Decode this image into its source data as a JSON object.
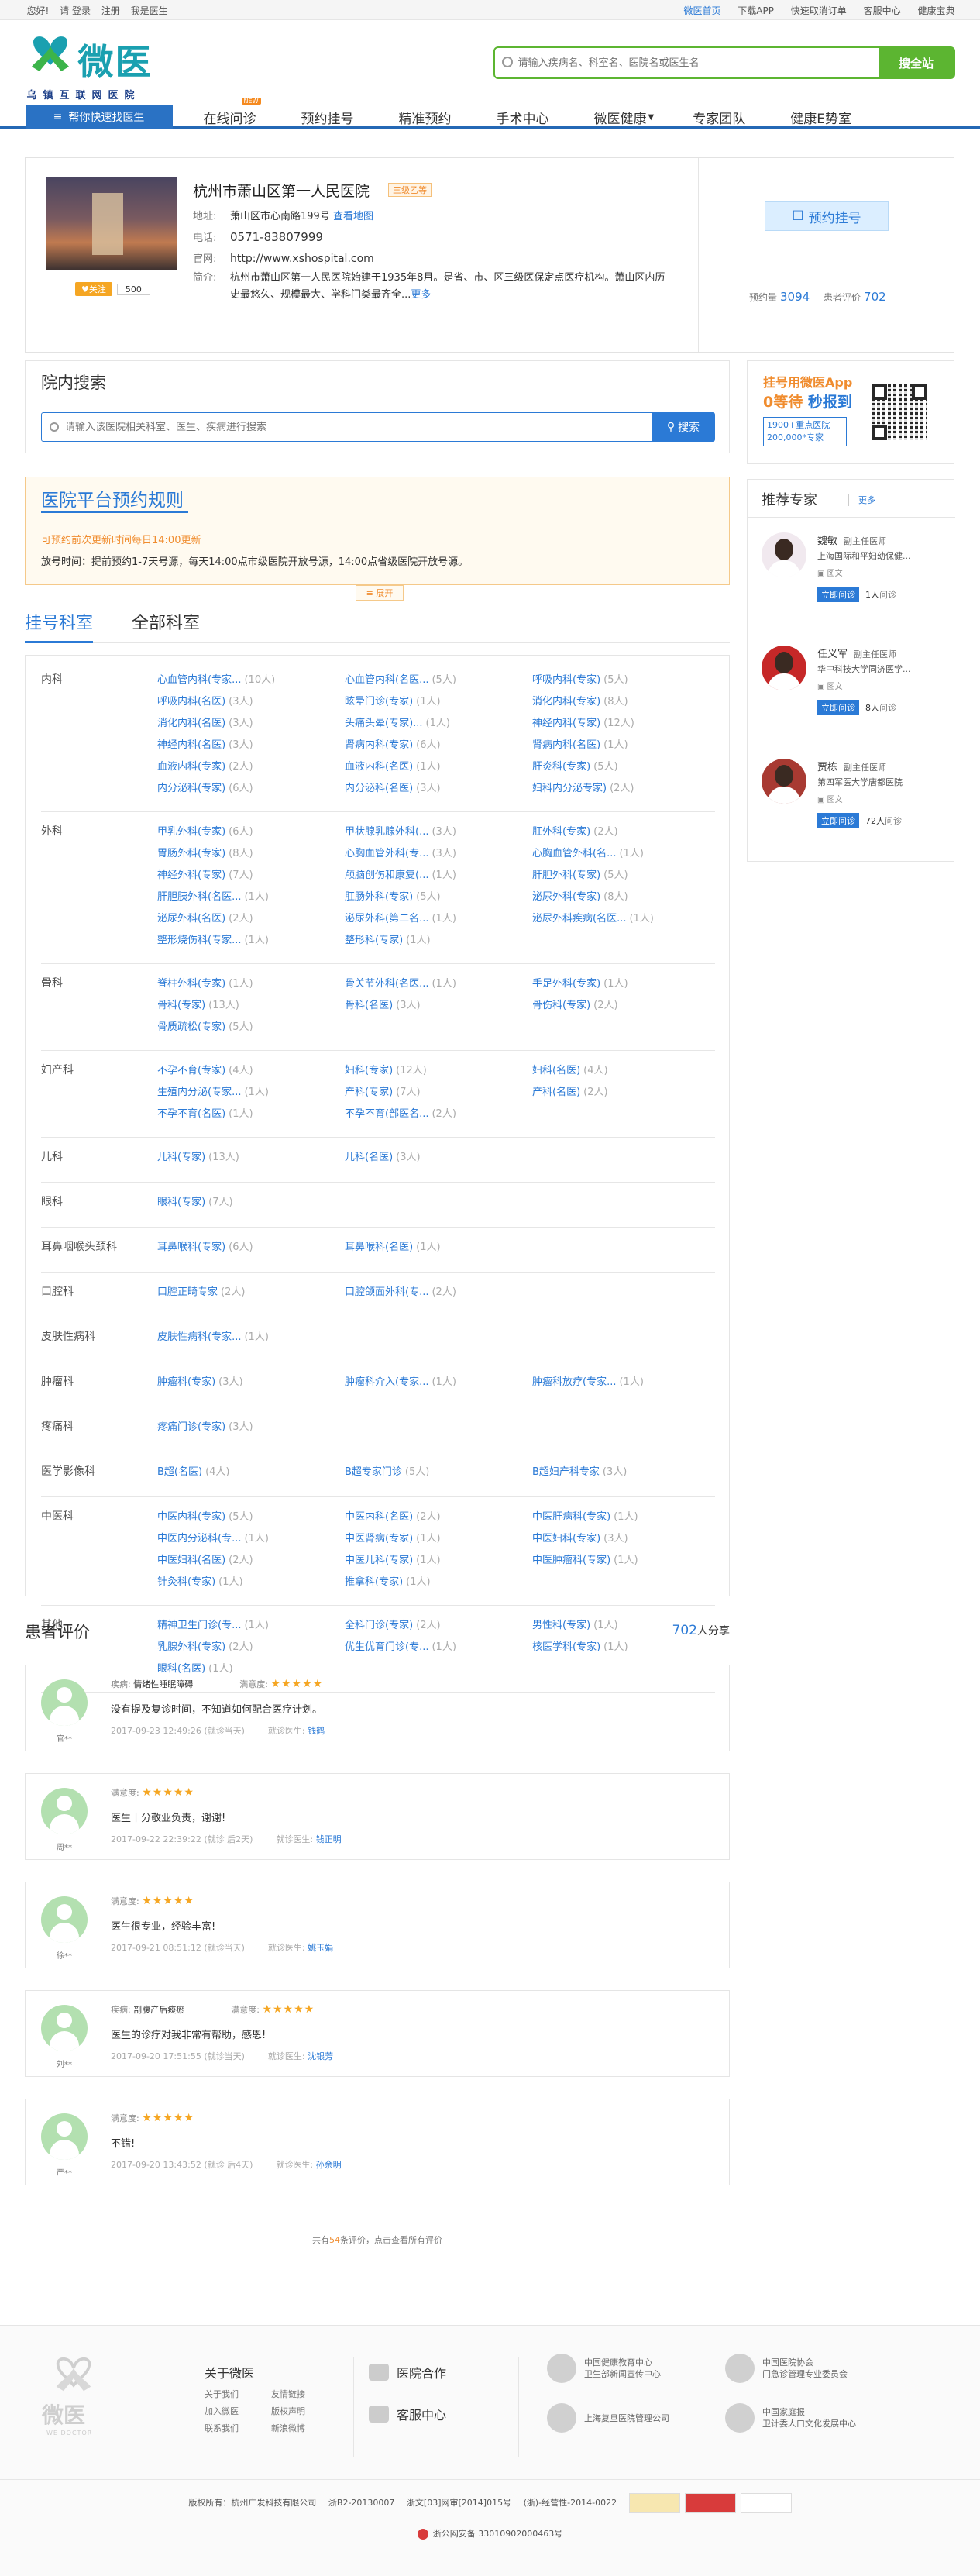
{
  "topbar": {
    "greeting": "您好!",
    "login": "请 登录",
    "register": "注册",
    "doctor_entry": "我是医生",
    "home": "微医首页",
    "download": "下载APP",
    "cancel_order": "快速取消订单",
    "service": "客服中心",
    "baike": "健康宝典"
  },
  "logo": {
    "name": "微医",
    "subtitle": "乌镇互联网医院"
  },
  "header_search": {
    "placeholder": "请输入疾病名、科室名、医院名或医生名",
    "button": "搜全站"
  },
  "nav": {
    "first": "帮你快速找医生",
    "items": [
      "在线问诊",
      "预约挂号",
      "精准预约",
      "手术中心",
      "微医健康",
      "专家团队",
      "健康E势室"
    ],
    "badge": "NEW",
    "dropdown_item": "微医健康"
  },
  "hospital": {
    "name": "杭州市萧山区第一人民医院",
    "level": "三级乙等",
    "follow": "关注",
    "follow_count": "500",
    "address_label": "地址:",
    "address": "萧山区市心南路199号",
    "view_map": "查看地图",
    "phone_label": "电话:",
    "phone": "0571-83807999",
    "site_label": "官网:",
    "site": "http://www.xshospital.com",
    "intro_label": "简介:",
    "intro": "杭州市萧山区第一人民医院始建于1935年8月。是省、市、区三级医保定点医疗机构。萧山区内历史最悠久、规模最大、学科门类最齐全...",
    "more": "更多",
    "book_button": "预约挂号",
    "appointments_label": "预约量",
    "appointments": "3094",
    "reviews_label": "患者评价",
    "reviews": "702"
  },
  "inner_search": {
    "title": "院内搜索",
    "placeholder": "请输入该医院相关科室、医生、疾病进行搜索",
    "button": "搜索"
  },
  "rules": {
    "title": "医院平台预约规则",
    "update": "可预约前次更新时间每日14:00更新",
    "time": "放号时间：提前预约1-7天号源，每天14:00点市级医院开放号源，14:00点省级医院开放号源。",
    "toggle": "≡ 展开"
  },
  "dept_tabs": [
    "挂号科室",
    "全部科室"
  ],
  "departments": [
    {
      "cat": "内科",
      "items": [
        [
          "心血管内科(专家...",
          "(10人)"
        ],
        [
          "心血管内科(名医...",
          "(5人)"
        ],
        [
          "呼吸内科(专家)",
          "(5人)"
        ],
        [
          "呼吸内科(名医)",
          "(3人)"
        ],
        [
          "眩晕门诊(专家)",
          "(1人)"
        ],
        [
          "消化内科(专家)",
          "(8人)"
        ],
        [
          "消化内科(名医)",
          "(3人)"
        ],
        [
          "头痛头晕(专家)...",
          "(1人)"
        ],
        [
          "神经内科(专家)",
          "(12人)"
        ],
        [
          "神经内科(名医)",
          "(3人)"
        ],
        [
          "肾病内科(专家)",
          "(6人)"
        ],
        [
          "肾病内科(名医)",
          "(1人)"
        ],
        [
          "血液内科(专家)",
          "(2人)"
        ],
        [
          "血液内科(名医)",
          "(1人)"
        ],
        [
          "肝炎科(专家)",
          "(5人)"
        ],
        [
          "内分泌科(专家)",
          "(6人)"
        ],
        [
          "内分泌科(名医)",
          "(3人)"
        ],
        [
          "妇科内分泌专家)",
          "(2人)"
        ]
      ]
    },
    {
      "cat": "外科",
      "items": [
        [
          "甲乳外科(专家)",
          "(6人)"
        ],
        [
          "甲状腺乳腺外科(...",
          "(3人)"
        ],
        [
          "肛外科(专家)",
          "(2人)"
        ],
        [
          "胃肠外科(专家)",
          "(8人)"
        ],
        [
          "心胸血管外科(专...",
          "(3人)"
        ],
        [
          "心胸血管外科(名...",
          "(1人)"
        ],
        [
          "神经外科(专家)",
          "(7人)"
        ],
        [
          "颅脑创伤和康复(...",
          "(1人)"
        ],
        [
          "肝胆外科(专家)",
          "(5人)"
        ],
        [
          "肝胆胰外科(名医...",
          "(1人)"
        ],
        [
          "肛肠外科(专家)",
          "(5人)"
        ],
        [
          "泌尿外科(专家)",
          "(8人)"
        ],
        [
          "泌尿外科(名医)",
          "(2人)"
        ],
        [
          "泌尿外科(第二名...",
          "(1人)"
        ],
        [
          "泌尿外科疾病(名医...",
          "(1人)"
        ],
        [
          "整形烧伤科(专家...",
          "(1人)"
        ],
        [
          "整形科(专家)",
          "(1人)"
        ]
      ]
    },
    {
      "cat": "骨科",
      "items": [
        [
          "脊柱外科(专家)",
          "(1人)"
        ],
        [
          "骨关节外科(名医...",
          "(1人)"
        ],
        [
          "手足外科(专家)",
          "(1人)"
        ],
        [
          "骨科(专家)",
          "(13人)"
        ],
        [
          "骨科(名医)",
          "(3人)"
        ],
        [
          "骨伤科(专家)",
          "(2人)"
        ],
        [
          "骨质疏松(专家)",
          "(5人)"
        ]
      ]
    },
    {
      "cat": "妇产科",
      "items": [
        [
          "不孕不育(专家)",
          "(4人)"
        ],
        [
          "妇科(专家)",
          "(12人)"
        ],
        [
          "妇科(名医)",
          "(4人)"
        ],
        [
          "生殖内分泌(专家...",
          "(1人)"
        ],
        [
          "产科(专家)",
          "(7人)"
        ],
        [
          "产科(名医)",
          "(2人)"
        ],
        [
          "不孕不育(名医)",
          "(1人)"
        ],
        [
          "不孕不育(部医名...",
          "(2人)"
        ]
      ]
    },
    {
      "cat": "儿科",
      "items": [
        [
          "儿科(专家)",
          "(13人)"
        ],
        [
          "儿科(名医)",
          "(3人)"
        ]
      ]
    },
    {
      "cat": "眼科",
      "items": [
        [
          "眼科(专家)",
          "(7人)"
        ]
      ]
    },
    {
      "cat": "耳鼻咽喉头颈科",
      "items": [
        [
          "耳鼻喉科(专家)",
          "(6人)"
        ],
        [
          "耳鼻喉科(名医)",
          "(1人)"
        ]
      ]
    },
    {
      "cat": "口腔科",
      "items": [
        [
          "口腔正畸专家",
          "(2人)"
        ],
        [
          "口腔颌面外科(专...",
          "(2人)"
        ]
      ]
    },
    {
      "cat": "皮肤性病科",
      "items": [
        [
          "皮肤性病科(专家...",
          "(1人)"
        ]
      ]
    },
    {
      "cat": "肿瘤科",
      "items": [
        [
          "肿瘤科(专家)",
          "(3人)"
        ],
        [
          "肿瘤科介入(专家...",
          "(1人)"
        ],
        [
          "肿瘤科放疗(专家...",
          "(1人)"
        ]
      ]
    },
    {
      "cat": "疼痛科",
      "items": [
        [
          "疼痛门诊(专家)",
          "(3人)"
        ]
      ]
    },
    {
      "cat": "医学影像科",
      "items": [
        [
          "B超(名医)",
          "(4人)"
        ],
        [
          "B超专家门诊",
          "(5人)"
        ],
        [
          "B超妇产科专家",
          "(3人)"
        ]
      ]
    },
    {
      "cat": "中医科",
      "items": [
        [
          "中医内科(专家)",
          "(5人)"
        ],
        [
          "中医内科(名医)",
          "(2人)"
        ],
        [
          "中医肝病科(专家)",
          "(1人)"
        ],
        [
          "中医内分泌科(专...",
          "(1人)"
        ],
        [
          "中医肾病(专家)",
          "(1人)"
        ],
        [
          "中医妇科(专家)",
          "(3人)"
        ],
        [
          "中医妇科(名医)",
          "(2人)"
        ],
        [
          "中医儿科(专家)",
          "(1人)"
        ],
        [
          "中医肿瘤科(专家)",
          "(1人)"
        ],
        [
          "针灸科(专家)",
          "(1人)"
        ],
        [
          "推拿科(专家)",
          "(1人)"
        ]
      ]
    },
    {
      "cat": "其他",
      "items": [
        [
          "精神卫生门诊(专...",
          "(1人)"
        ],
        [
          "全科门诊(专家)",
          "(2人)"
        ],
        [
          "男性科(专家)",
          "(1人)"
        ],
        [
          "乳腺外科(专家)",
          "(2人)"
        ],
        [
          "优生优育门诊(专...",
          "(1人)"
        ],
        [
          "核医学科(专家)",
          "(1人)"
        ],
        [
          "眼科(名医)",
          "(1人)"
        ]
      ]
    }
  ],
  "app_promo": {
    "line1": "挂号用微医App",
    "line2a": "0等待",
    "line2b": "秒报到",
    "line3": "1900+重点医院 200,000*专家"
  },
  "recommend": {
    "title": "推荐专家",
    "more": "更多",
    "ask_label": "立即问诊",
    "ask_suffix": "问诊",
    "pictext": "图文",
    "doctors": [
      {
        "name": "魏敏",
        "title": "副主任医师",
        "hospital": "上海国际和平妇幼保健...",
        "count": "1人"
      },
      {
        "name": "任义军",
        "title": "副主任医师",
        "hospital": "华中科技大学同济医学...",
        "count": "8人"
      },
      {
        "name": "贾栋",
        "title": "副主任医师",
        "hospital": "第四军医大学唐都医院",
        "count": "72人"
      }
    ]
  },
  "reviews_header": {
    "title": "患者评价",
    "count": "702",
    "suffix": "人分享"
  },
  "reviews": [
    {
      "user": "官**",
      "disease_label": "疾病:",
      "disease": "情绪性睡眠障碍",
      "rating_label": "满意度:",
      "stars": "★★★★★",
      "text": "没有提及复诊时间，不知道如何配合医疗计划。",
      "time": "2017-09-23 12:49:26",
      "status": "(就诊当天)",
      "doctor_label": "就诊医生:",
      "doctor": "钱鹤"
    },
    {
      "user": "周**",
      "disease_label": "",
      "disease": "",
      "rating_label": "满意度:",
      "stars": "★★★★★",
      "text": "医生十分敬业负责，谢谢!",
      "time": "2017-09-22 22:39:22",
      "status": "(就诊 后2天)",
      "doctor_label": "就诊医生:",
      "doctor": "钱正明"
    },
    {
      "user": "徐**",
      "disease_label": "",
      "disease": "",
      "rating_label": "满意度:",
      "stars": "★★★★★",
      "text": "医生很专业，经验丰富!",
      "time": "2017-09-21 08:51:12",
      "status": "(就诊当天)",
      "doctor_label": "就诊医生:",
      "doctor": "姚玉娟"
    },
    {
      "user": "刘**",
      "disease_label": "疾病:",
      "disease": "剖腹产后痰瘀",
      "rating_label": "满意度:",
      "stars": "★★★★★",
      "text": "医生的诊疗对我非常有帮助，感恩!",
      "time": "2017-09-20 17:51:55",
      "status": "(就诊当天)",
      "doctor_label": "就诊医生:",
      "doctor": "沈银芳"
    },
    {
      "user": "严**",
      "disease_label": "",
      "disease": "",
      "rating_label": "满意度:",
      "stars": "★★★★★",
      "text": "不错!",
      "time": "2017-09-20 13:43:52",
      "status": "(就诊 后4天)",
      "doctor_label": "就诊医生:",
      "doctor": "孙余明"
    }
  ],
  "all_reviews": {
    "pre": "共有",
    "count": "54",
    "post": "条评价，点击查看所有评价"
  },
  "footer": {
    "logo": "微医",
    "logo_en": "WE DOCTOR",
    "about_title": "关于微医",
    "about_links": [
      "关于我们",
      "友情链接",
      "加入微医",
      "版权声明",
      "联系我们",
      "新浪微博"
    ],
    "coop": "医院合作",
    "service": "客服中心",
    "orgs": [
      [
        "中国健康教育中心",
        "卫生部新闻宣传中心"
      ],
      [
        "中国医院协会",
        "门急诊管理专业委员会"
      ],
      [
        "上海复旦医院管理公司",
        ""
      ],
      [
        "中国家庭报",
        "卫计委人口文化发展中心"
      ]
    ],
    "copyright": "版权所有：杭州广发科技有限公司",
    "icp1": "浙B2-20130007",
    "icp2": "浙文[03]网审[2014]015号",
    "icp3": "(浙)-经营性-2014-0022",
    "police": "浙公网安备 33010902000463号"
  },
  "colors": {
    "brand": "#2b7ad6",
    "green": "#5cb531",
    "orange": "#f08c2e",
    "star": "#f5a623"
  }
}
